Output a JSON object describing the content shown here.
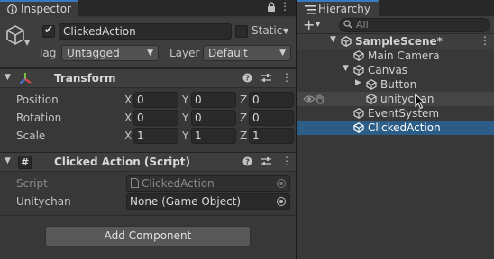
{
  "inspector": {
    "tab_label": "Inspector",
    "go_name": "ClickedAction",
    "static_label": "Static",
    "tag_label": "Tag",
    "tag_value": "Untagged",
    "layer_label": "Layer",
    "layer_value": "Default",
    "transform": {
      "title": "Transform",
      "rows": [
        {
          "label": "Position",
          "x": "0",
          "y": "0",
          "z": "0"
        },
        {
          "label": "Rotation",
          "x": "0",
          "y": "0",
          "z": "0"
        },
        {
          "label": "Scale",
          "x": "1",
          "y": "1",
          "z": "1"
        }
      ],
      "axis_x": "X",
      "axis_y": "Y",
      "axis_z": "Z"
    },
    "script_component": {
      "title": "Clicked Action (Script)",
      "script_label": "Script",
      "script_value": "ClickedAction",
      "field_label": "Unitychan",
      "field_value": "None (Game Object)"
    },
    "add_component_label": "Add Component"
  },
  "hierarchy": {
    "tab_label": "Hierarchy",
    "plus_label": "+",
    "search_placeholder": "All",
    "scene_name": "SampleScene*",
    "items": [
      {
        "label": "Main Camera"
      },
      {
        "label": "Canvas"
      },
      {
        "label": "Button"
      },
      {
        "label": "unitychan"
      },
      {
        "label": "EventSystem"
      },
      {
        "label": "ClickedAction"
      }
    ]
  },
  "colors": {
    "selection": "#2c5d87",
    "tab_accent": "#3a79bb",
    "panel_bg": "#383838"
  }
}
